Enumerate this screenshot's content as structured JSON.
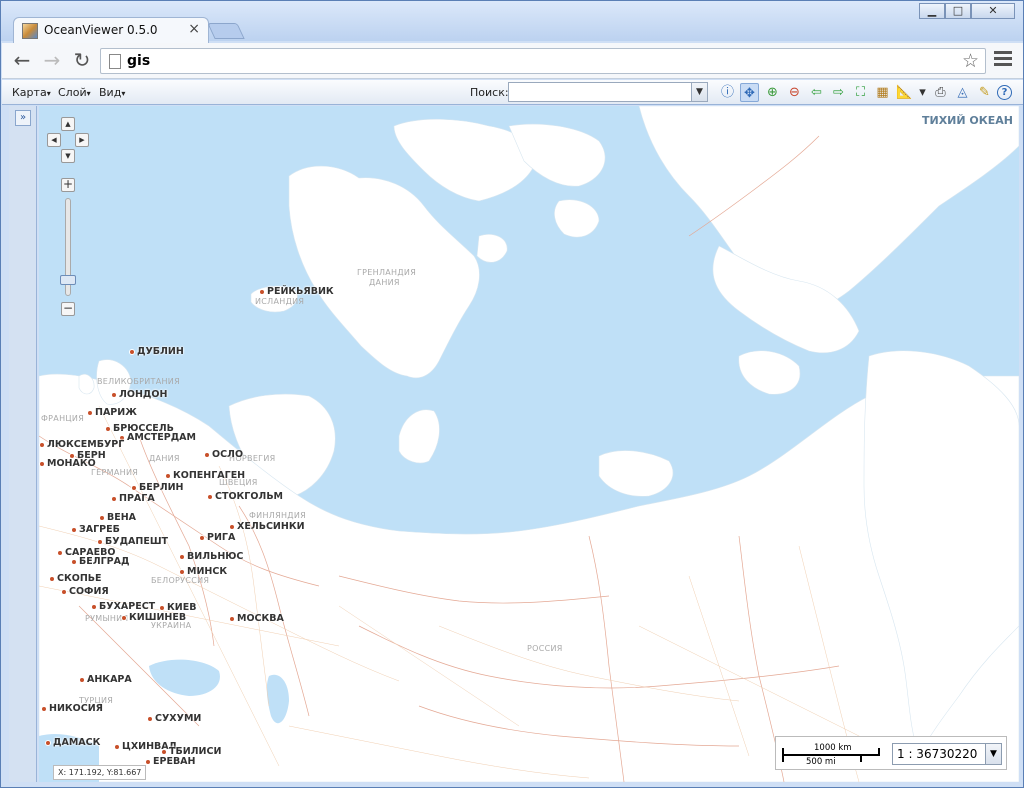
{
  "browser": {
    "tab_title": "OceanViewer 0.5.0",
    "tab_close": "×",
    "address": "gis",
    "window_buttons": {
      "minimize": "▁",
      "maximize": "□",
      "close": "✕"
    },
    "nav": {
      "back": "←",
      "forward": "→",
      "reload": "↻",
      "star": "☆"
    }
  },
  "toolbar": {
    "menus": [
      {
        "label": "Карта"
      },
      {
        "label": "Слой"
      },
      {
        "label": "Вид"
      }
    ],
    "caret": "▾",
    "search_label": "Поиск:",
    "search_value": "",
    "search_dropdown": "▼",
    "tools": [
      {
        "icon": "info-icon",
        "glyph": "ⓘ",
        "color": "#2f6ab7"
      },
      {
        "icon": "pan-icon",
        "glyph": "✥",
        "color": "#2f6ab7",
        "active": true
      },
      {
        "icon": "zoom-in-icon",
        "glyph": "⊕",
        "color": "#3a9a3a"
      },
      {
        "icon": "zoom-out-icon",
        "glyph": "⊖",
        "color": "#c8452c"
      },
      {
        "icon": "previous-extent-icon",
        "glyph": "⇦",
        "color": "#2e9e3a"
      },
      {
        "icon": "next-extent-icon",
        "glyph": "⇨",
        "color": "#2e9e3a"
      },
      {
        "icon": "full-extent-icon",
        "glyph": "⛶",
        "color": "#2e9e3a"
      },
      {
        "icon": "layer-table-icon",
        "glyph": "▦",
        "color": "#b07a1a"
      },
      {
        "icon": "measure-icon",
        "glyph": "📐",
        "color": "#d08a20"
      },
      {
        "icon": "measure-dropdown-icon",
        "glyph": "▾",
        "color": "#333"
      },
      {
        "icon": "print-icon",
        "glyph": "⎙",
        "color": "#444"
      },
      {
        "icon": "chart-icon",
        "glyph": "◬",
        "color": "#3a6fb7"
      },
      {
        "icon": "edit-icon",
        "glyph": "✎",
        "color": "#c39a1a"
      },
      {
        "icon": "help-icon",
        "glyph": "?",
        "color": "#2f6ab7"
      }
    ]
  },
  "side_panel": {
    "expand_glyph": "»"
  },
  "map": {
    "ocean_label": "ТИХИЙ ОКЕАН",
    "cities": [
      {
        "name": "РЕЙКЬЯВИК"
      },
      {
        "name": "ДУБЛИН"
      },
      {
        "name": "ЛОНДОН"
      },
      {
        "name": "ПАРИЖ"
      },
      {
        "name": "БРЮССЕЛЬ"
      },
      {
        "name": "АМСТЕРДАМ"
      },
      {
        "name": "ЛЮКСЕМБУРГ"
      },
      {
        "name": "БЕРН"
      },
      {
        "name": "МОНАКО"
      },
      {
        "name": "ОСЛО"
      },
      {
        "name": "КОПЕНГАГЕН"
      },
      {
        "name": "БЕРЛИН"
      },
      {
        "name": "СТОКГОЛЬМ"
      },
      {
        "name": "ПРАГА"
      },
      {
        "name": "ВЕНА"
      },
      {
        "name": "ЗАГРЕБ"
      },
      {
        "name": "БУДАПЕШТ"
      },
      {
        "name": "САРАЕВО"
      },
      {
        "name": "БЕЛГРАД"
      },
      {
        "name": "СКОПЬЕ"
      },
      {
        "name": "СОФИЯ"
      },
      {
        "name": "БУХАРЕСТ"
      },
      {
        "name": "КИШИНЕВ"
      },
      {
        "name": "КИЕВ"
      },
      {
        "name": "МИНСК"
      },
      {
        "name": "ВИЛЬНЮС"
      },
      {
        "name": "РИГА"
      },
      {
        "name": "ХЕЛЬСИНКИ"
      },
      {
        "name": "МОСКВА"
      },
      {
        "name": "АНКАРА"
      },
      {
        "name": "НИКОСИЯ"
      },
      {
        "name": "СУХУМИ"
      },
      {
        "name": "ДАМАСК"
      },
      {
        "name": "ЦХИНВАЛ"
      },
      {
        "name": "ТБИЛИСИ"
      },
      {
        "name": "ЕРЕВАН"
      }
    ],
    "countries": [
      {
        "name": "ГРЕНЛАНДИЯ"
      },
      {
        "name": "ДАНИЯ"
      },
      {
        "name": "ИСЛАНДИЯ"
      },
      {
        "name": "ВЕЛИКОБРИТАНИЯ"
      },
      {
        "name": "ФРАНЦИЯ"
      },
      {
        "name": "ГЕРМАНИЯ"
      },
      {
        "name": "ДАНИЯ"
      },
      {
        "name": "НОРВЕГИЯ"
      },
      {
        "name": "ШВЕЦИЯ"
      },
      {
        "name": "ФИНЛЯНДИЯ"
      },
      {
        "name": "БЕЛОРУССИЯ"
      },
      {
        "name": "РУМЫНИЯ"
      },
      {
        "name": "УКРАИНА"
      },
      {
        "name": "ТУРЦИЯ"
      },
      {
        "name": "РОССИЯ"
      }
    ],
    "nav": {
      "up": "▲",
      "down": "▼",
      "left": "◀",
      "right": "▶",
      "zoom_in": "+",
      "zoom_out": "−"
    },
    "coordinates": "X: 171.192, Y:81.667",
    "scale_bar": {
      "top_label": "1000 km",
      "bottom_label": "500 mi"
    },
    "scale_select": {
      "value": "1 : 36730220",
      "dropdown": "▼"
    }
  },
  "colors": {
    "water": "#bfe0f7",
    "land": "#ffffff",
    "border_line": "#e0a090",
    "road": "#f0c9a0",
    "city_dot": "#c8502a"
  }
}
